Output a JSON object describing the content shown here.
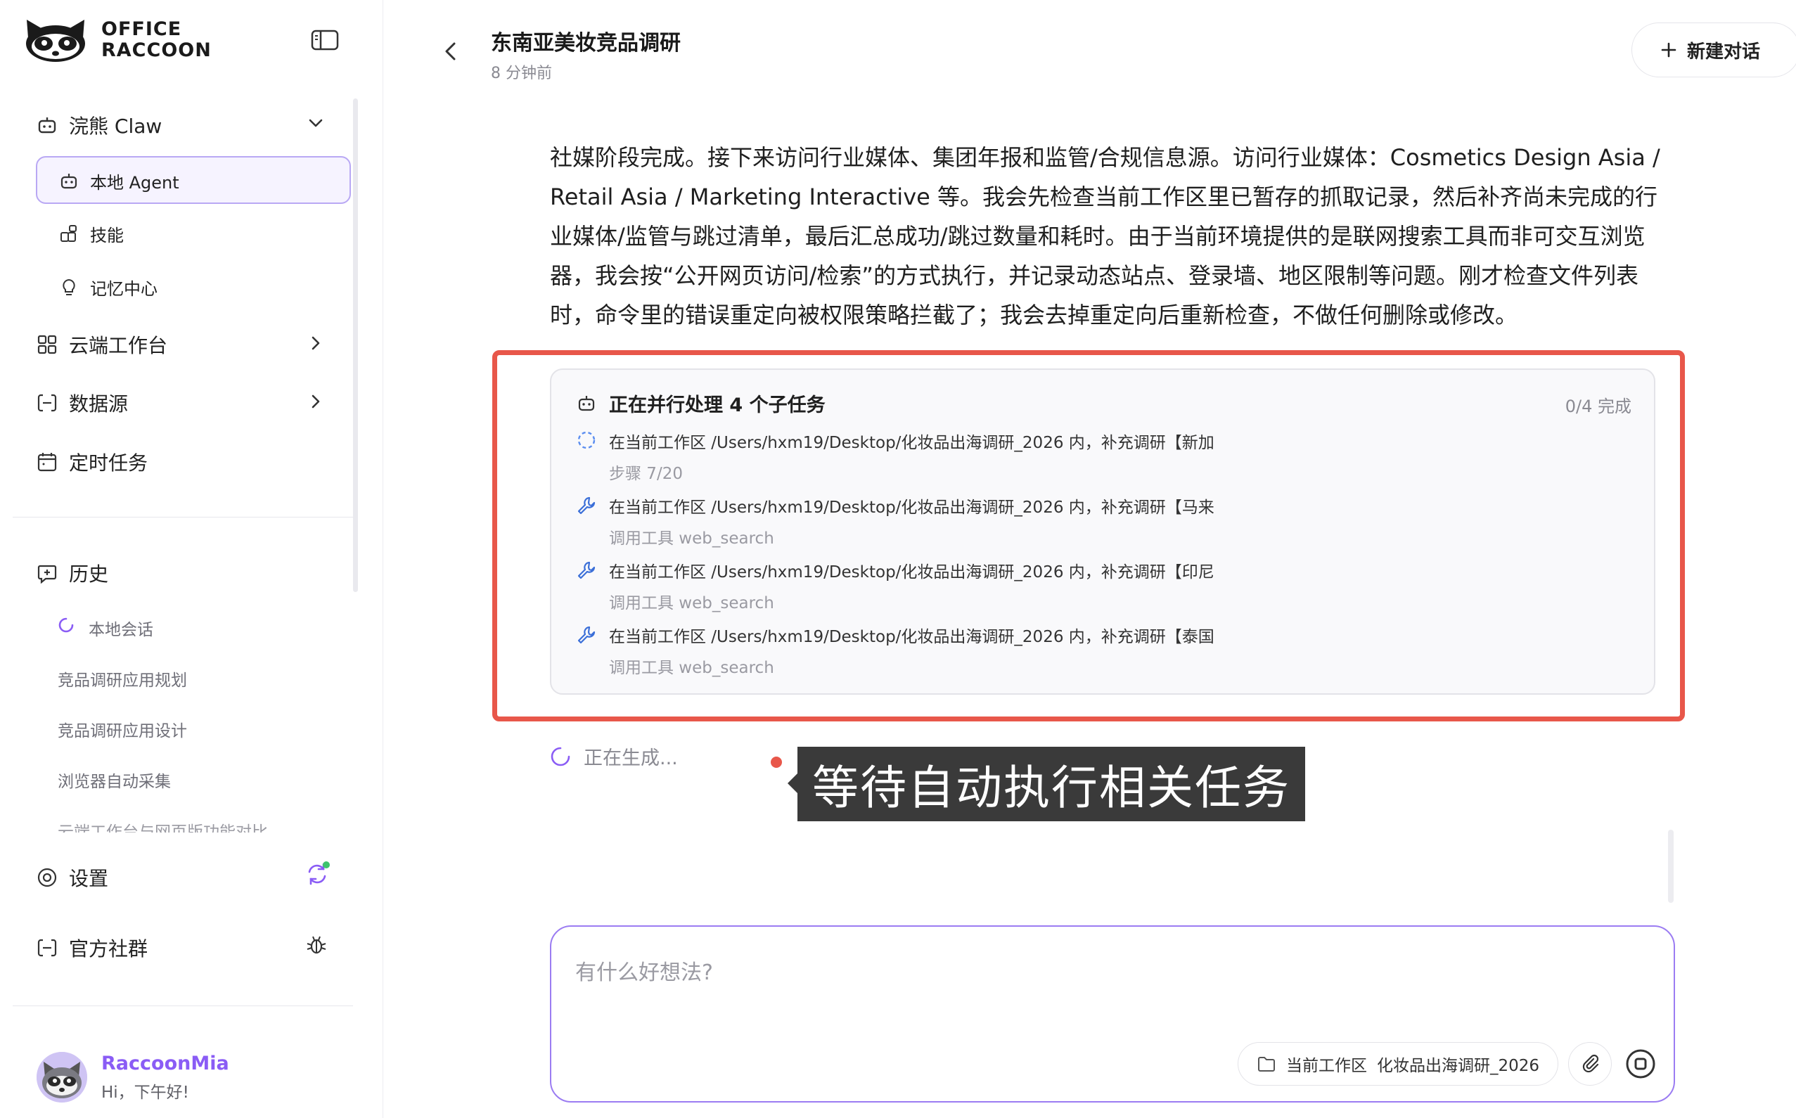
{
  "brand": {
    "line1": "OFFICE",
    "line2": "RACCOON"
  },
  "sidebar": {
    "claw_label": "浣熊 Claw",
    "local_agent": "本地 Agent",
    "skills": "技能",
    "memory": "记忆中心",
    "cloud": "云端工作台",
    "datasource": "数据源",
    "scheduled": "定时任务",
    "history_label": "历史",
    "history": [
      "本地会话",
      "竞品调研应用规划",
      "竞品调研应用设计",
      "浏览器自动采集",
      "云端工作台与网页版功能对比"
    ],
    "settings": "设置",
    "community": "官方社群"
  },
  "user": {
    "name": "RaccoonMia",
    "greeting": "Hi，下午好!"
  },
  "header": {
    "title": "东南亚美妆竞品调研",
    "time": "8 分钟前",
    "new_chat": "新建对话"
  },
  "message": "社媒阶段完成。接下来访问行业媒体、集团年报和监管/合规信息源。访问行业媒体：Cosmetics Design Asia / Retail Asia / Marketing Interactive 等。我会先检查当前工作区里已暂存的抓取记录，然后补齐尚未完成的行业媒体/监管与跳过清单，最后汇总成功/跳过数量和耗时。由于当前环境提供的是联网搜索工具而非可交互浏览器，我会按“公开网页访问/检索”的方式执行，并记录动态站点、登录墙、地区限制等问题。刚才检查文件列表时，命令里的错误重定向被权限策略拦截了；我会去掉重定向后重新检查，不做任何删除或修改。",
  "tasks": {
    "heading": "正在并行处理 4 个子任务",
    "count": "0/4 完成",
    "items": [
      {
        "title": "在当前工作区 /Users/hxm19/Desktop/化妆品出海调研_2026 内，补充调研【新加",
        "sub": "步骤 7/20"
      },
      {
        "title": "在当前工作区 /Users/hxm19/Desktop/化妆品出海调研_2026 内，补充调研【马来",
        "sub": "调用工具 web_search"
      },
      {
        "title": "在当前工作区 /Users/hxm19/Desktop/化妆品出海调研_2026 内，补充调研【印尼",
        "sub": "调用工具 web_search"
      },
      {
        "title": "在当前工作区 /Users/hxm19/Desktop/化妆品出海调研_2026 内，补充调研【泰国",
        "sub": "调用工具 web_search"
      }
    ]
  },
  "status": {
    "generating": "正在生成..."
  },
  "caption": "等待自动执行相关任务",
  "input": {
    "placeholder": "有什么好想法?",
    "workspace_label": "当前工作区",
    "workspace_name": "化妆品出海调研_2026"
  },
  "colors": {
    "accent": "#8a5cf5",
    "highlight": "#e8574a",
    "caption_bg": "#3a3a3a"
  }
}
